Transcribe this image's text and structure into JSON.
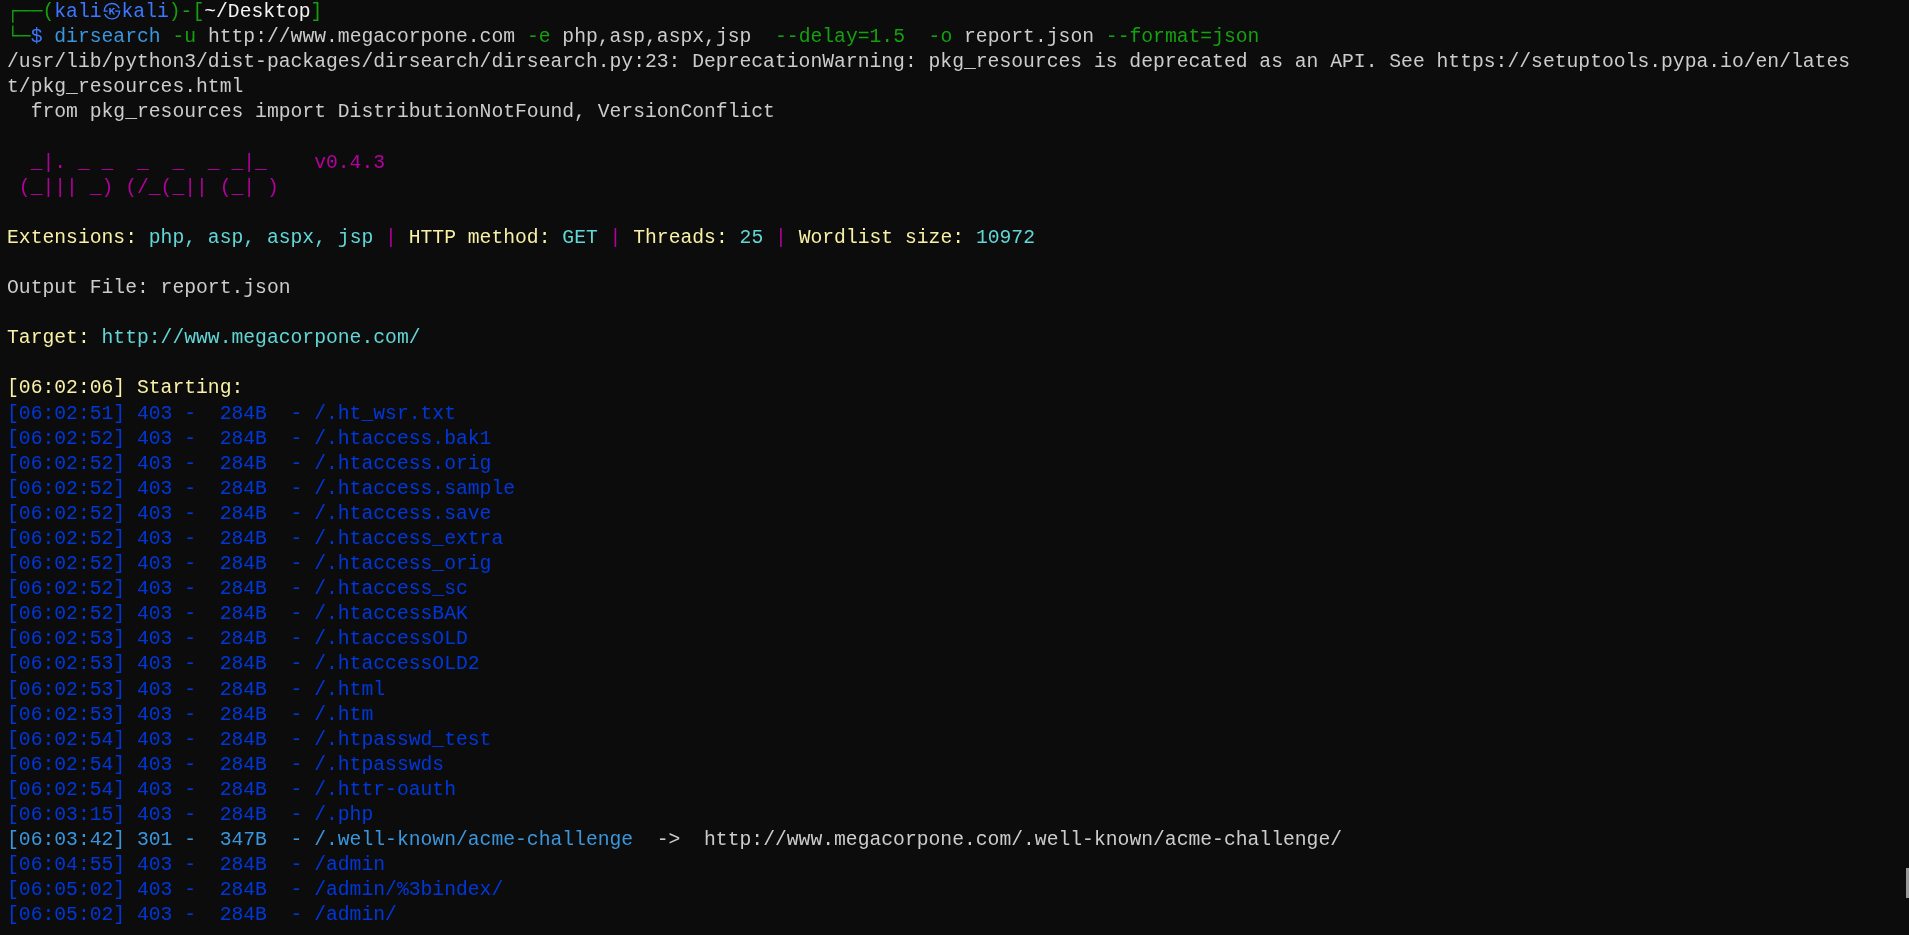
{
  "terminal": {
    "lines": [
      {
        "kind": "text",
        "segments": [
          {
            "text": "┌──(",
            "kind": "frame"
          },
          {
            "text": "kali㉿kali",
            "kind": "user"
          },
          {
            "text": ")-[",
            "kind": "frame"
          },
          {
            "text": "~/Desktop",
            "kind": "bright"
          },
          {
            "text": "]",
            "kind": "frame"
          }
        ]
      },
      {
        "kind": "text",
        "segments": [
          {
            "text": "└─",
            "kind": "frame"
          },
          {
            "text": "$ ",
            "kind": "user"
          },
          {
            "text": "dirsearch ",
            "kind": "command"
          },
          {
            "text": "-u ",
            "kind": "flag"
          },
          {
            "text": "http://www.megacorpone.com ",
            "kind": "plain"
          },
          {
            "text": "-e ",
            "kind": "flag"
          },
          {
            "text": "php,asp,aspx,jsp  ",
            "kind": "plain"
          },
          {
            "text": "--delay=1.5  -o ",
            "kind": "flag"
          },
          {
            "text": "report.json ",
            "kind": "plain"
          },
          {
            "text": "--format=json",
            "kind": "flag"
          }
        ]
      },
      {
        "kind": "text",
        "segments": [
          {
            "text": "/usr/lib/python3/dist-packages/dirsearch/dirsearch.py:23: DeprecationWarning: pkg_resources is deprecated as an API. See https://setuptools.pypa.io/en/lates",
            "kind": "plain"
          }
        ]
      },
      {
        "kind": "text",
        "segments": [
          {
            "text": "t/pkg_resources.html",
            "kind": "plain"
          }
        ]
      },
      {
        "kind": "text",
        "segments": [
          {
            "text": "  from pkg_resources import DistributionNotFound, VersionConflict",
            "kind": "plain"
          }
        ]
      },
      {
        "kind": "blank"
      },
      {
        "kind": "text",
        "segments": [
          {
            "text": "  _|. _ _  _  _  _ _|_    v0.4.3",
            "kind": "banner"
          }
        ]
      },
      {
        "kind": "text",
        "segments": [
          {
            "text": " (_||| _) (/_(_|| (_| )",
            "kind": "banner"
          }
        ]
      },
      {
        "kind": "blank"
      },
      {
        "kind": "text",
        "segments": [
          {
            "text": "Extensions: ",
            "kind": "label"
          },
          {
            "text": "php, asp, aspx, jsp",
            "kind": "value"
          },
          {
            "text": " | ",
            "kind": "separator"
          },
          {
            "text": "HTTP method: ",
            "kind": "label"
          },
          {
            "text": "GET",
            "kind": "value"
          },
          {
            "text": " | ",
            "kind": "separator"
          },
          {
            "text": "Threads: ",
            "kind": "label"
          },
          {
            "text": "25",
            "kind": "value"
          },
          {
            "text": " | ",
            "kind": "separator"
          },
          {
            "text": "Wordlist size: ",
            "kind": "label"
          },
          {
            "text": "10972",
            "kind": "value"
          }
        ]
      },
      {
        "kind": "blank"
      },
      {
        "kind": "text",
        "segments": [
          {
            "text": "Output File: report.json",
            "kind": "plain"
          }
        ]
      },
      {
        "kind": "blank"
      },
      {
        "kind": "text",
        "segments": [
          {
            "text": "Target: ",
            "kind": "label"
          },
          {
            "text": "http://www.megacorpone.com/",
            "kind": "value"
          }
        ]
      },
      {
        "kind": "blank"
      },
      {
        "kind": "text",
        "segments": [
          {
            "text": "[06:02:06] Starting: ",
            "kind": "label"
          }
        ]
      },
      {
        "kind": "text",
        "segments": [
          {
            "text": "[06:02:51] 403 -  284B  - /.ht_wsr.txt",
            "kind": "forbidden"
          }
        ]
      },
      {
        "kind": "text",
        "segments": [
          {
            "text": "[06:02:52] 403 -  284B  - /.htaccess.bak1",
            "kind": "forbidden"
          }
        ]
      },
      {
        "kind": "text",
        "segments": [
          {
            "text": "[06:02:52] 403 -  284B  - /.htaccess.orig",
            "kind": "forbidden"
          }
        ]
      },
      {
        "kind": "text",
        "segments": [
          {
            "text": "[06:02:52] 403 -  284B  - /.htaccess.sample",
            "kind": "forbidden"
          }
        ]
      },
      {
        "kind": "text",
        "segments": [
          {
            "text": "[06:02:52] 403 -  284B  - /.htaccess.save",
            "kind": "forbidden"
          }
        ]
      },
      {
        "kind": "text",
        "segments": [
          {
            "text": "[06:02:52] 403 -  284B  - /.htaccess_extra",
            "kind": "forbidden"
          }
        ]
      },
      {
        "kind": "text",
        "segments": [
          {
            "text": "[06:02:52] 403 -  284B  - /.htaccess_orig",
            "kind": "forbidden"
          }
        ]
      },
      {
        "kind": "text",
        "segments": [
          {
            "text": "[06:02:52] 403 -  284B  - /.htaccess_sc",
            "kind": "forbidden"
          }
        ]
      },
      {
        "kind": "text",
        "segments": [
          {
            "text": "[06:02:52] 403 -  284B  - /.htaccessBAK",
            "kind": "forbidden"
          }
        ]
      },
      {
        "kind": "text",
        "segments": [
          {
            "text": "[06:02:53] 403 -  284B  - /.htaccessOLD",
            "kind": "forbidden"
          }
        ]
      },
      {
        "kind": "text",
        "segments": [
          {
            "text": "[06:02:53] 403 -  284B  - /.htaccessOLD2",
            "kind": "forbidden"
          }
        ]
      },
      {
        "kind": "text",
        "segments": [
          {
            "text": "[06:02:53] 403 -  284B  - /.html",
            "kind": "forbidden"
          }
        ]
      },
      {
        "kind": "text",
        "segments": [
          {
            "text": "[06:02:53] 403 -  284B  - /.htm",
            "kind": "forbidden"
          }
        ]
      },
      {
        "kind": "text",
        "segments": [
          {
            "text": "[06:02:54] 403 -  284B  - /.htpasswd_test",
            "kind": "forbidden"
          }
        ]
      },
      {
        "kind": "text",
        "segments": [
          {
            "text": "[06:02:54] 403 -  284B  - /.htpasswds",
            "kind": "forbidden"
          }
        ]
      },
      {
        "kind": "text",
        "segments": [
          {
            "text": "[06:02:54] 403 -  284B  - /.httr-oauth",
            "kind": "forbidden"
          }
        ]
      },
      {
        "kind": "text",
        "segments": [
          {
            "text": "[06:03:15] 403 -  284B  - /.php",
            "kind": "forbidden"
          }
        ]
      },
      {
        "kind": "text",
        "segments": [
          {
            "text": "[06:03:42] 301 -  347B  - /.well-known/acme-challenge",
            "kind": "redirect"
          },
          {
            "text": "  ->  http://www.megacorpone.com/.well-known/acme-challenge/",
            "kind": "plain"
          }
        ]
      },
      {
        "kind": "text",
        "segments": [
          {
            "text": "[06:04:55] 403 -  284B  - /admin",
            "kind": "forbidden"
          }
        ]
      },
      {
        "kind": "text",
        "segments": [
          {
            "text": "[06:05:02] 403 -  284B  - /admin/%3bindex/",
            "kind": "forbidden"
          }
        ]
      },
      {
        "kind": "text",
        "segments": [
          {
            "text": "[06:05:02] 403 -  284B  - /admin/",
            "kind": "forbidden"
          }
        ]
      }
    ]
  }
}
